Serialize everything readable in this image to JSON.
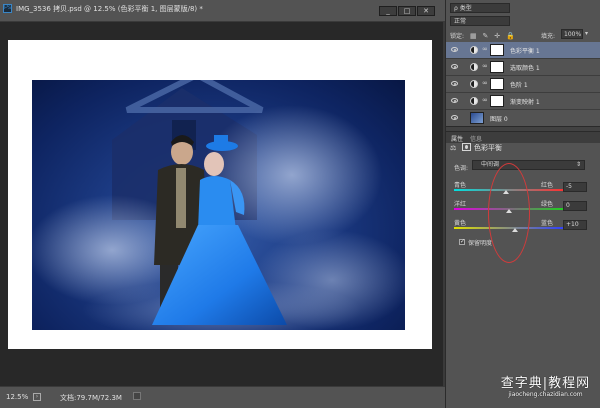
{
  "document": {
    "title": "IMG_3536 拷贝.psd @ 12.5% (色彩平衡 1, 图层蒙版/8) *",
    "app_icon": "Ps",
    "zoom": "12.5%",
    "doc_size": "文档:79.7M/72.3M",
    "window_buttons": {
      "minimize": "_",
      "maximize": "□",
      "close": "✕"
    }
  },
  "layers_panel": {
    "filter": "ρ 类型",
    "blend_mode": "正常",
    "lock_label": "锁定:",
    "opacity_label": "填充:",
    "opacity_value": "100%",
    "layers": [
      {
        "name": "色彩平衡 1",
        "selected": true,
        "type": "adjustment"
      },
      {
        "name": "选取颜色 1",
        "selected": false,
        "type": "adjustment"
      },
      {
        "name": "色阶 1",
        "selected": false,
        "type": "adjustment"
      },
      {
        "name": "渐变映射 1",
        "selected": false,
        "type": "adjustment"
      },
      {
        "name": "图层 0",
        "selected": false,
        "type": "image"
      }
    ]
  },
  "properties_panel": {
    "tabs": [
      "属性",
      "信息"
    ],
    "title": "色彩平衡",
    "tone_label": "色调:",
    "tone_value": "中间调",
    "sliders": [
      {
        "left": "青色",
        "right": "红色",
        "value": "-5",
        "colors": [
          "#00e0e0",
          "#ff3030"
        ],
        "position": 0.475
      },
      {
        "left": "洋红",
        "right": "绿色",
        "value": "0",
        "colors": [
          "#e000e0",
          "#20d020"
        ],
        "position": 0.5
      },
      {
        "left": "黄色",
        "right": "蓝色",
        "value": "+10",
        "colors": [
          "#e0e000",
          "#3040ff"
        ],
        "position": 0.55
      }
    ],
    "preserve_luminosity": "保留明度",
    "preserve_checked": "✓"
  },
  "watermark": {
    "main": "查字典|教程网",
    "sub": "jiaocheng.chazidian.com"
  },
  "colors": {
    "panel_bg": "#535353",
    "canvas_bg": "#282828",
    "selected_layer": "#677693",
    "annotation": "#d23b3b"
  }
}
